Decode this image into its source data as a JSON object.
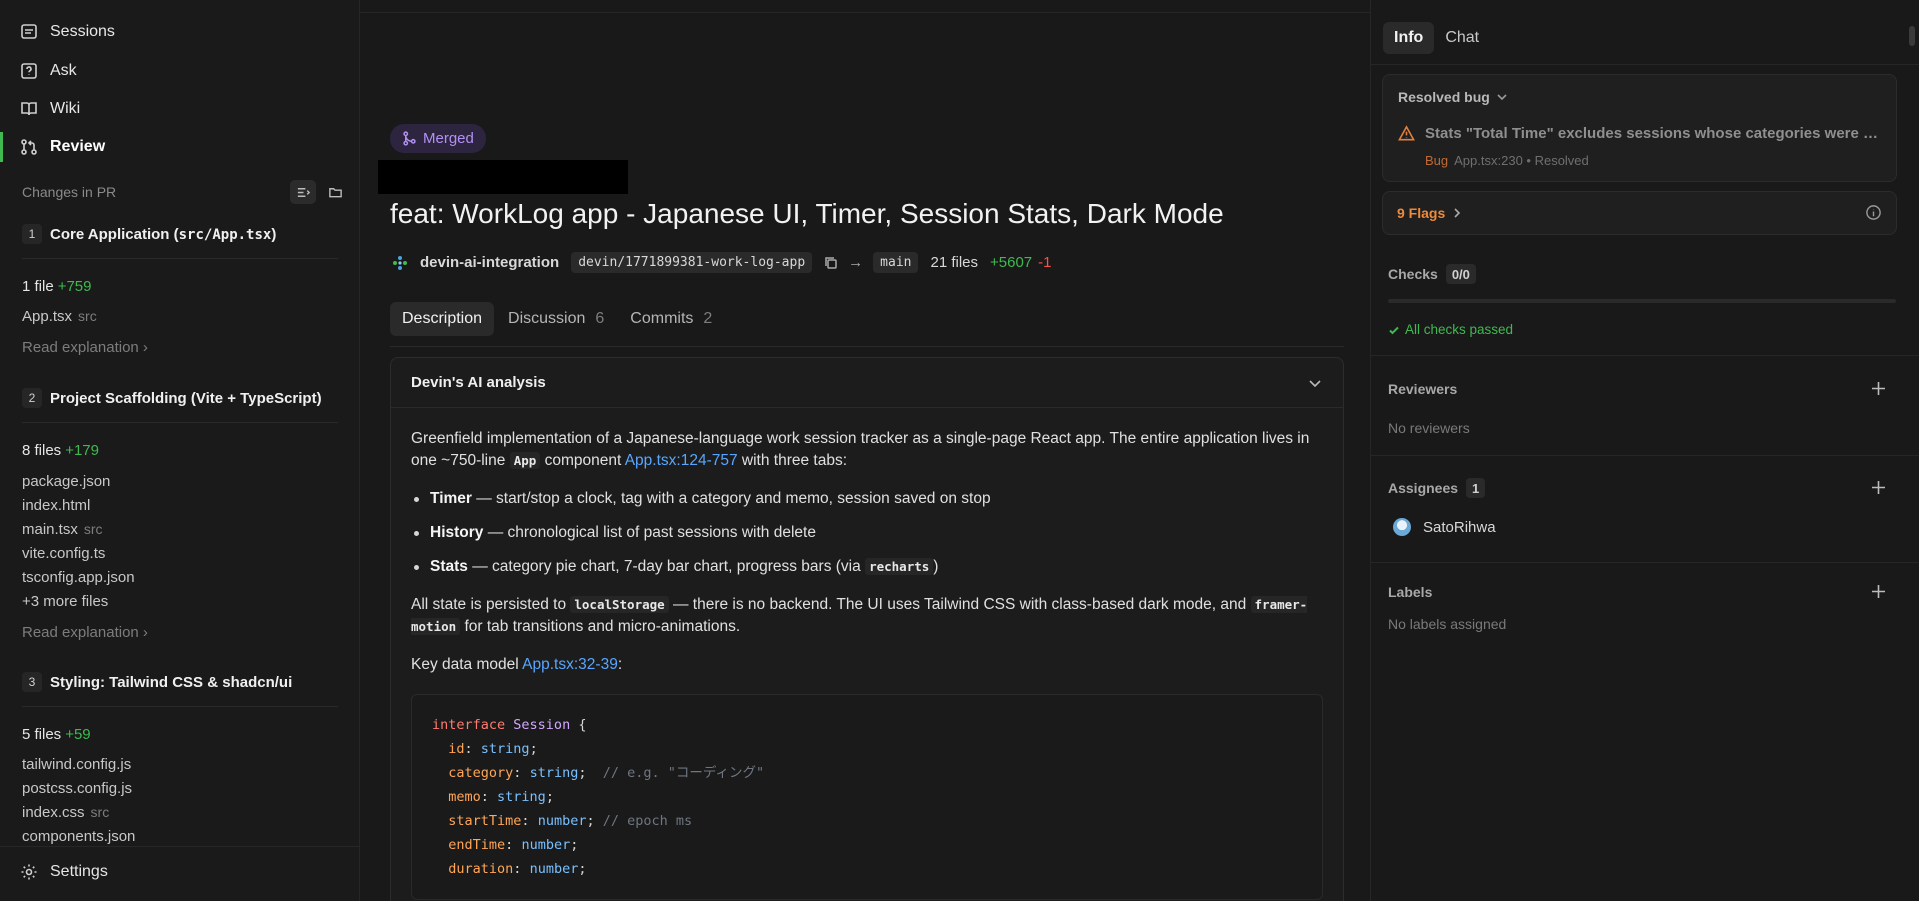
{
  "nav": {
    "sessions": "Sessions",
    "ask": "Ask",
    "wiki": "Wiki",
    "review": "Review"
  },
  "sidebar": {
    "changes_header": "Changes in PR",
    "sections": [
      {
        "num": "1",
        "title_prefix": "Core Application (",
        "title_code": "src/App.tsx",
        "title_suffix": ")",
        "file_count": "1 file",
        "additions": "+759",
        "files": [
          {
            "name": "App.tsx",
            "dir": "src"
          }
        ],
        "more": "",
        "read": "Read explanation"
      },
      {
        "num": "2",
        "title_prefix": "Project Scaffolding (Vite + TypeScript)",
        "title_code": "",
        "title_suffix": "",
        "file_count": "8 files",
        "additions": "+179",
        "files": [
          {
            "name": "package.json",
            "dir": ""
          },
          {
            "name": "index.html",
            "dir": ""
          },
          {
            "name": "main.tsx",
            "dir": "src"
          },
          {
            "name": "vite.config.ts",
            "dir": ""
          },
          {
            "name": "tsconfig.app.json",
            "dir": ""
          }
        ],
        "more": "+3 more files",
        "read": "Read explanation"
      },
      {
        "num": "3",
        "title_prefix": "Styling: Tailwind CSS & shadcn/ui",
        "title_code": "",
        "title_suffix": "",
        "file_count": "5 files",
        "additions": "+59",
        "files": [
          {
            "name": "tailwind.config.js",
            "dir": ""
          },
          {
            "name": "postcss.config.js",
            "dir": ""
          },
          {
            "name": "index.css",
            "dir": "src"
          },
          {
            "name": "components.json",
            "dir": ""
          }
        ],
        "more": "",
        "read": ""
      }
    ],
    "settings": "Settings"
  },
  "pr": {
    "status": "Merged",
    "title": "feat: WorkLog app - Japanese UI, Timer, Session Stats, Dark Mode",
    "org": "devin-ai-integration",
    "branch": "devin/1771899381-work-log-app",
    "arrow": "→",
    "base": "main",
    "files": "21 files",
    "additions": "+5607",
    "deletions": "-1"
  },
  "tabs": [
    {
      "label": "Description",
      "count": ""
    },
    {
      "label": "Discussion",
      "count": "6"
    },
    {
      "label": "Commits",
      "count": "2"
    }
  ],
  "analysis": {
    "heading": "Devin's AI analysis",
    "p1_a": "Greenfield implementation of a Japanese-language work session tracker as a single-page React app. The entire application lives in one ~750-line ",
    "p1_code": "App",
    "p1_b": " component ",
    "p1_link": "App.tsx:124-757",
    "p1_c": " with three tabs:",
    "bullets": [
      {
        "bold": "Timer",
        "text": " — start/stop a clock, tag with a category and memo, session saved on stop",
        "code": "",
        "tail": ""
      },
      {
        "bold": "History",
        "text": " — chronological list of past sessions with delete",
        "code": "",
        "tail": ""
      },
      {
        "bold": "Stats",
        "text": " — category pie chart, 7-day bar chart, progress bars (via ",
        "code": "recharts",
        "tail": ")"
      }
    ],
    "p2_a": "All state is persisted to ",
    "p2_code1": "localStorage",
    "p2_b": " — there is no backend. The UI uses Tailwind CSS with class-based dark mode, and ",
    "p2_code2": "framer-motion",
    "p2_c": " for tab transitions and micro-animations.",
    "p3_a": "Key data model ",
    "p3_link": "App.tsx:32-39",
    "p3_b": ":",
    "code": {
      "kw": "interface",
      "type": "Session",
      "fields": [
        {
          "name": "id",
          "type": "string",
          "comment": ""
        },
        {
          "name": "category",
          "type": "string",
          "comment": "// e.g. \"コーディング\""
        },
        {
          "name": "memo",
          "type": "string",
          "comment": ""
        },
        {
          "name": "startTime",
          "type": "number",
          "comment": "// epoch ms"
        },
        {
          "name": "endTime",
          "type": "number",
          "comment": ""
        },
        {
          "name": "duration",
          "type": "number",
          "comment": ""
        }
      ]
    }
  },
  "right": {
    "tabs": [
      "Info",
      "Chat"
    ],
    "bug_header": "Resolved bug",
    "bug_text": "Stats \"Total Time\" excludes sessions whose categories were de...",
    "bug_tag": "Bug",
    "bug_meta": "App.tsx:230 • Resolved",
    "flags": "9 Flags",
    "checks_label": "Checks",
    "checks_count": "0/0",
    "checks_progress": 0,
    "checks_status": "All checks passed",
    "reviewers_label": "Reviewers",
    "reviewers_empty": "No reviewers",
    "assignees_label": "Assignees",
    "assignees_count": "1",
    "assignee": "SatoRihwa",
    "labels_label": "Labels",
    "labels_empty": "No labels assigned"
  }
}
